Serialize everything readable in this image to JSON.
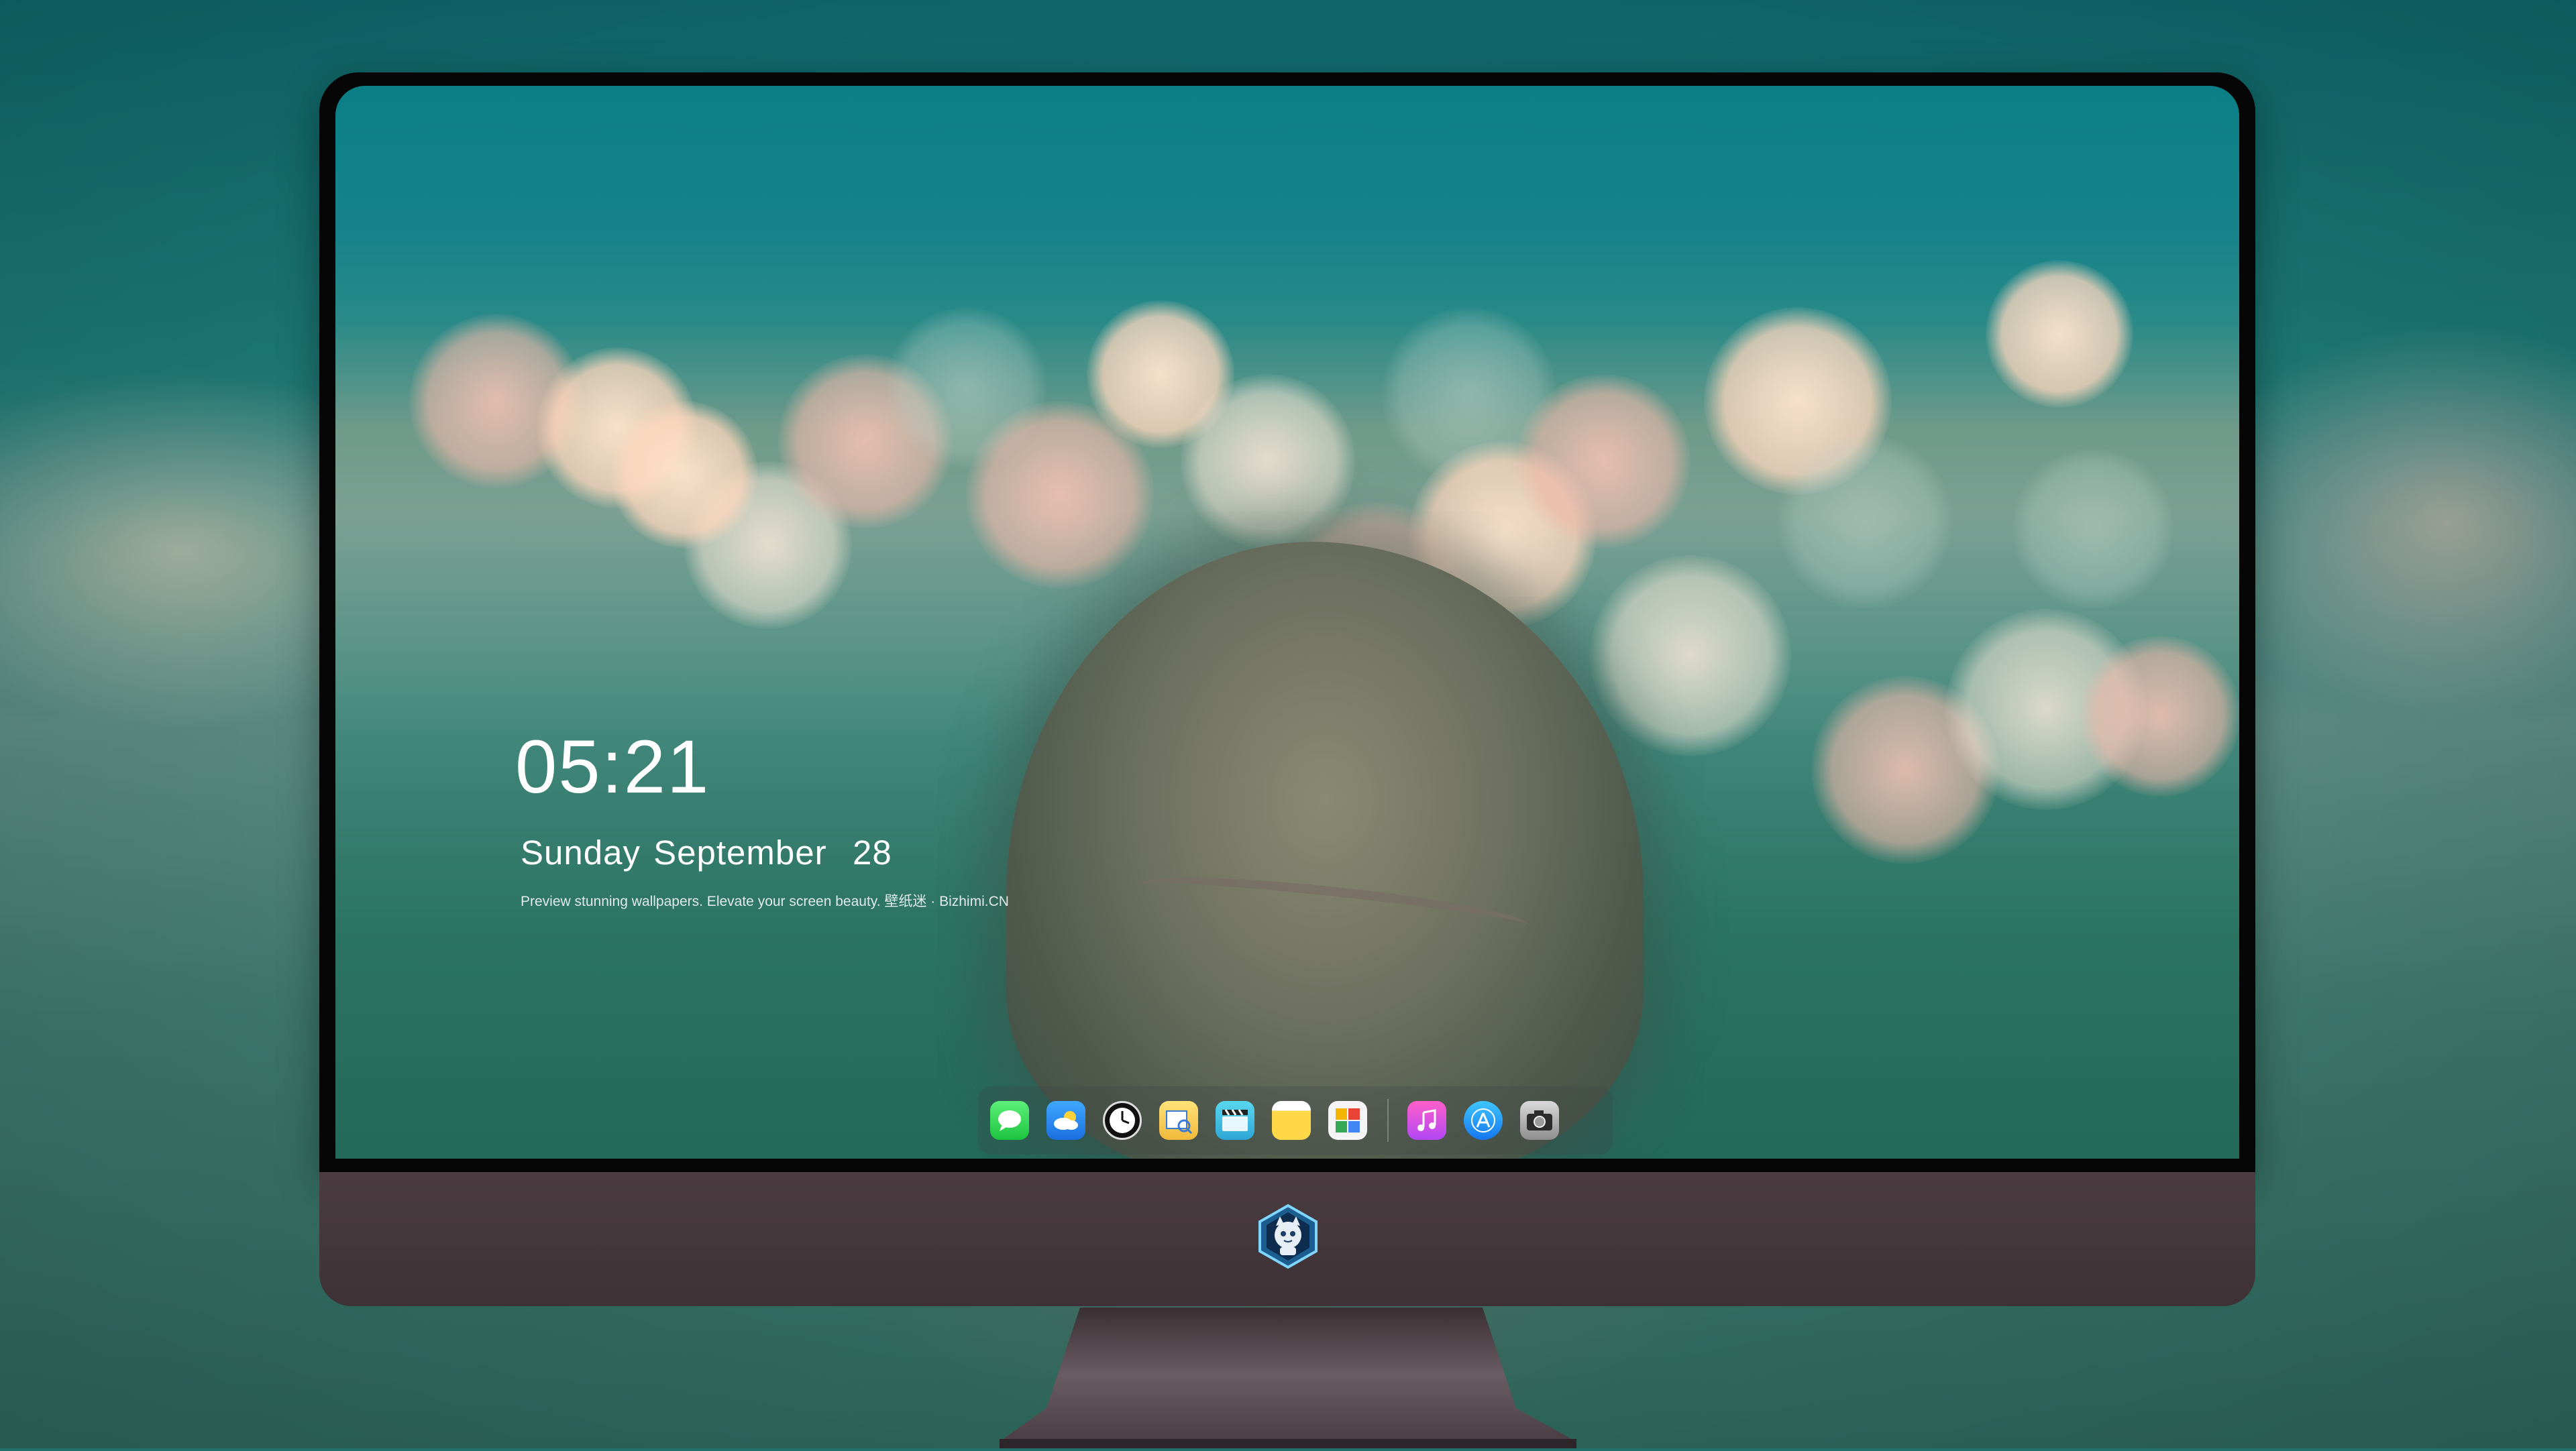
{
  "lock_screen": {
    "time": "05:21",
    "date": "Sunday September  28",
    "tagline": "Preview stunning wallpapers. Elevate your screen beauty. 壁纸迷 · Bizhimi.CN"
  },
  "dock": {
    "apps": [
      {
        "name": "Messages",
        "glyph": "💬"
      },
      {
        "name": "Weather",
        "glyph": "☁"
      },
      {
        "name": "Clock",
        "glyph": "🕐"
      },
      {
        "name": "Preview",
        "glyph": "🖼"
      },
      {
        "name": "Clips",
        "glyph": "🎬"
      },
      {
        "name": "Notes",
        "glyph": ""
      },
      {
        "name": "Photos",
        "glyph": "▦"
      },
      {
        "name": "Music",
        "glyph": "♫"
      },
      {
        "name": "App Store",
        "glyph": "A"
      },
      {
        "name": "Camera",
        "glyph": "📷"
      }
    ]
  },
  "colors": {
    "chin": "#4a3c40",
    "bezel": "#060606",
    "wallpaper_teal": "#17838a"
  }
}
